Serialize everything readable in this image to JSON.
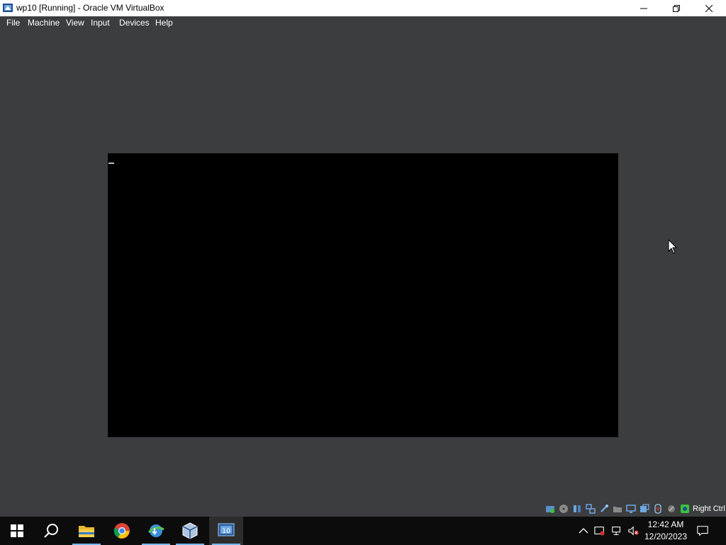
{
  "window": {
    "title": "wp10 [Running] - Oracle VM VirtualBox"
  },
  "menu": {
    "items": [
      "File",
      "Machine",
      "View",
      "Input",
      "Devices",
      "Help"
    ]
  },
  "statusbar": {
    "host_key_label": "Right Ctrl",
    "icons": [
      "hard-disk-icon",
      "optical-drive-icon",
      "audio-icon",
      "network-icon",
      "usb-icon",
      "shared-folders-icon",
      "display-icon",
      "recording-icon",
      "mouse-integration-icon",
      "keyboard-icon"
    ]
  },
  "taskbar": {
    "apps": [
      "start-button",
      "search-button",
      "file-explorer-icon",
      "chrome-icon",
      "internet-download-manager-icon",
      "virtualbox-icon",
      "vm-wp10-icon"
    ],
    "clock_time": "12:42 AM",
    "clock_date": "12/20/2023"
  },
  "colors": {
    "vm_background": "#3c3d3f",
    "taskbar": "#0c0c0c",
    "accent": "#76b9ed"
  }
}
